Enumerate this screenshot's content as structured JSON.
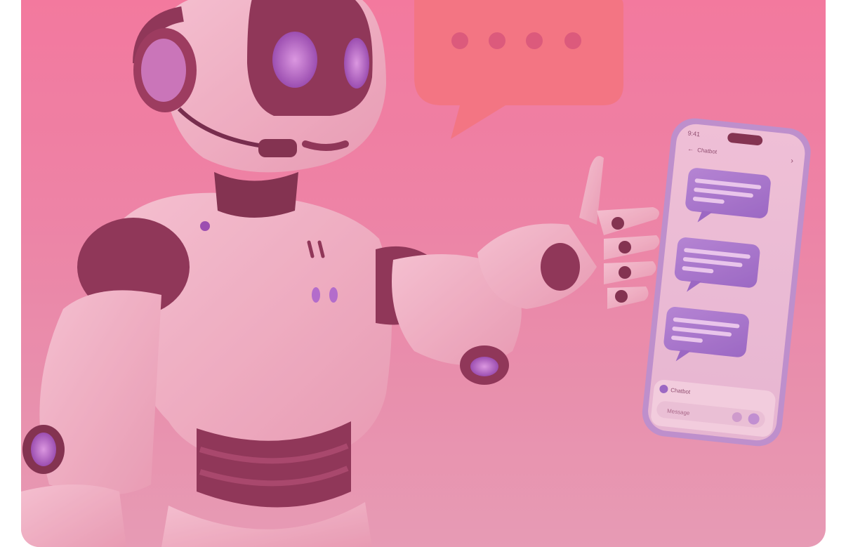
{
  "scene": {
    "background": {
      "top_color": "#f47fa2",
      "bottom_color": "#e6a9bd"
    },
    "speech_bubble": {
      "color": "#f47a80",
      "dot_color": "#d85a78",
      "dot_count": 4
    },
    "robot": {
      "shell_color": "#f2c9d4",
      "dark_color": "#7c2f4d",
      "eye_color": "#b06bd6"
    },
    "phone": {
      "status_time": "9:41",
      "header_title": "Chatbot",
      "bubble_color": "#9a7ad8",
      "input_label": "Chatbot",
      "input_placeholder": "Message"
    }
  }
}
